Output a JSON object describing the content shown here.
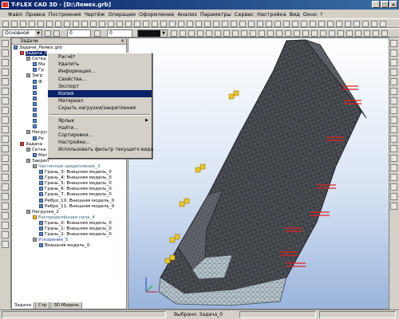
{
  "window": {
    "title": "T-FLEX CAD 3D - [D:\\Лемех.grb]"
  },
  "menu": [
    "Файл",
    "Правка",
    "Построения",
    "Чертёж",
    "Операции",
    "Оформление",
    "Анализ",
    "Параметры",
    "Сервис",
    "Настройка",
    "Вид",
    "Окно",
    "?"
  ],
  "toolbar": {
    "layer_value": "Основной",
    "num1_value": "0",
    "num2_value": "0"
  },
  "panel": {
    "title": "Задачи",
    "tree": [
      {
        "label": "Задачи_Лемех.grb",
        "indent": 0,
        "icon": "blue"
      },
      {
        "label": "Задача_0",
        "indent": 1,
        "icon": "red",
        "selected": true
      },
      {
        "label": "Сетка",
        "indent": 2,
        "icon": "gray"
      },
      {
        "label": "Ма",
        "indent": 3,
        "icon": "blue"
      },
      {
        "label": "Гр",
        "indent": 3,
        "icon": "blue"
      },
      {
        "label": "Загр",
        "indent": 2,
        "icon": "gray"
      },
      {
        "label": "Ф",
        "indent": 3,
        "icon": "blue"
      },
      {
        "label": "",
        "indent": 3,
        "icon": "blue"
      },
      {
        "label": "",
        "indent": 3,
        "icon": "blue"
      },
      {
        "label": "",
        "indent": 3,
        "icon": "blue"
      },
      {
        "label": "",
        "indent": 3,
        "icon": "blue"
      },
      {
        "label": "",
        "indent": 3,
        "icon": "blue"
      },
      {
        "label": "",
        "indent": 3,
        "icon": "blue"
      },
      {
        "label": "",
        "indent": 3,
        "icon": "blue"
      },
      {
        "label": "",
        "indent": 3,
        "icon": "blue"
      },
      {
        "label": "Нагрузка",
        "indent": 2,
        "icon": "gray"
      },
      {
        "label": "Ре",
        "indent": 3,
        "icon": "blue"
      },
      {
        "label": "Задача",
        "indent": 1,
        "icon": "red"
      },
      {
        "label": "Сетка",
        "indent": 2,
        "icon": "gray"
      },
      {
        "label": "Мат",
        "indent": 3,
        "icon": "blue"
      },
      {
        "label": "Закреп",
        "indent": 2,
        "icon": "gray"
      },
      {
        "label": "Частичное закрепление_3",
        "indent": 3,
        "icon": "gray",
        "color": "teal"
      },
      {
        "label": "Грань_3: Внешняя модель_0",
        "indent": 4,
        "icon": "blue"
      },
      {
        "label": "Грань_4: Внешняя модель_0",
        "indent": 4,
        "icon": "blue"
      },
      {
        "label": "Грань_5: Внешняя модель_0",
        "indent": 4,
        "icon": "blue"
      },
      {
        "label": "Грань_6: Внешняя модель_0",
        "indent": 4,
        "icon": "blue"
      },
      {
        "label": "Грань_7: Внешняя модель_0",
        "indent": 4,
        "icon": "blue"
      },
      {
        "label": "Ребро_10: Внешняя модель_0",
        "indent": 4,
        "icon": "blue"
      },
      {
        "label": "Ребро_11: Внешняя модель_0",
        "indent": 4,
        "icon": "blue"
      },
      {
        "label": "Нагрузки_2",
        "indent": 2,
        "icon": "gray"
      },
      {
        "label": "Распределённая сила_4",
        "indent": 3,
        "icon": "yel",
        "color": "teal"
      },
      {
        "label": "Грань_0: Внешняя модель_0",
        "indent": 4,
        "icon": "blue"
      },
      {
        "label": "Грань_1: Внешняя модель_0",
        "indent": 4,
        "icon": "blue"
      },
      {
        "label": "Грань_2: Внешняя модель_0",
        "indent": 4,
        "icon": "blue"
      },
      {
        "label": "Ускорение_5",
        "indent": 3,
        "icon": "gray",
        "color": "blue"
      },
      {
        "label": "Внешняя модель_0",
        "indent": 4,
        "icon": "blue"
      }
    ],
    "tabs": [
      "Задачи",
      "Стр",
      "3D Модель"
    ]
  },
  "context_menu": {
    "items": [
      {
        "label": "Расчёт",
        "type": "item"
      },
      {
        "label": "Удалить",
        "type": "item"
      },
      {
        "label": "Информация...",
        "type": "item"
      },
      {
        "label": "Свойства...",
        "type": "item"
      },
      {
        "label": "Экспорт",
        "type": "item"
      },
      {
        "label": "Копия",
        "type": "item",
        "highlighted": true
      },
      {
        "label": "Материал",
        "type": "item"
      },
      {
        "label": "Скрыть нагрузки/закрепления",
        "type": "item"
      },
      {
        "type": "sep"
      },
      {
        "label": "Ярлык",
        "type": "item",
        "submenu": true
      },
      {
        "label": "Найти...",
        "type": "item"
      },
      {
        "label": "Сортировки...",
        "type": "item"
      },
      {
        "label": "Настройки...",
        "type": "item"
      },
      {
        "label": "Использовать фильтр текущего вида",
        "type": "item"
      }
    ]
  },
  "status": {
    "text": "Выбрано: Задача_0"
  },
  "colors": {
    "title_bar": "#0a246a",
    "selection": "#0a246a",
    "mesh": "#3c3f44",
    "load_arrows": "#e02020",
    "constraints": "#e8c020"
  }
}
